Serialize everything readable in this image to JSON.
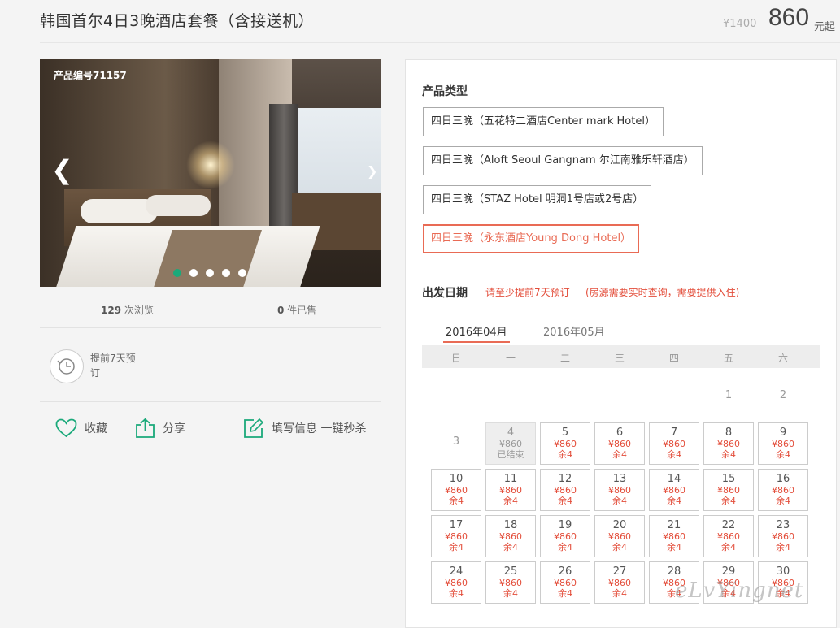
{
  "header": {
    "title": "韩国首尔4日3晚酒店套餐（含接送机）",
    "old_price": "¥1400",
    "price": "860",
    "price_unit": "元起"
  },
  "gallery": {
    "product_id": "产品编号71157",
    "slide_count": 5,
    "active_slide": 1
  },
  "stats": {
    "views_num": "129",
    "views_label": " 次浏览",
    "sold_num": "0",
    "sold_label": " 件已售"
  },
  "booking_note": "提前7天预订",
  "actions": {
    "favorite": "收藏",
    "share": "分享",
    "fill_info": "填写信息 一键秒杀"
  },
  "product_type": {
    "title": "产品类型",
    "options": [
      "四日三晚（五花特二酒店Center mark Hotel）",
      "四日三晚（Aloft Seoul Gangnam 尔江南雅乐轩酒店）",
      "四日三晚（STAZ Hotel 明洞1号店或2号店）",
      "四日三晚（永东酒店Young Dong Hotel）"
    ],
    "selected": 3
  },
  "departure": {
    "title": "出发日期",
    "note1": "请至少提前7天预订",
    "note2": "(房源需要实时查询，需要提供入住)"
  },
  "calendar": {
    "months": [
      "2016年04月",
      "2016年05月"
    ],
    "active_month": 0,
    "weekdays": [
      "日",
      "一",
      "二",
      "三",
      "四",
      "五",
      "六"
    ],
    "ended_label": "已结束",
    "days": [
      {
        "d": "1",
        "p": "",
        "s": ""
      },
      {
        "d": "2",
        "p": "",
        "s": ""
      },
      {
        "d": "3",
        "p": "",
        "s": ""
      },
      {
        "d": "4",
        "p": "¥860",
        "s": "已结束"
      },
      {
        "d": "5",
        "p": "¥860",
        "s": "余4"
      },
      {
        "d": "6",
        "p": "¥860",
        "s": "余4"
      },
      {
        "d": "7",
        "p": "¥860",
        "s": "余4"
      },
      {
        "d": "8",
        "p": "¥860",
        "s": "余4"
      },
      {
        "d": "9",
        "p": "¥860",
        "s": "余4"
      },
      {
        "d": "10",
        "p": "¥860",
        "s": "余4"
      },
      {
        "d": "11",
        "p": "¥860",
        "s": "余4"
      },
      {
        "d": "12",
        "p": "¥860",
        "s": "余4"
      },
      {
        "d": "13",
        "p": "¥860",
        "s": "余4"
      },
      {
        "d": "14",
        "p": "¥860",
        "s": "余4"
      },
      {
        "d": "15",
        "p": "¥860",
        "s": "余4"
      },
      {
        "d": "16",
        "p": "¥860",
        "s": "余4"
      },
      {
        "d": "17",
        "p": "¥860",
        "s": "余4"
      },
      {
        "d": "18",
        "p": "¥860",
        "s": "余4"
      },
      {
        "d": "19",
        "p": "¥860",
        "s": "余4"
      },
      {
        "d": "20",
        "p": "¥860",
        "s": "余4"
      },
      {
        "d": "21",
        "p": "¥860",
        "s": "余4"
      },
      {
        "d": "22",
        "p": "¥860",
        "s": "余4"
      },
      {
        "d": "23",
        "p": "¥860",
        "s": "余4"
      },
      {
        "d": "24",
        "p": "¥860",
        "s": "余4"
      },
      {
        "d": "25",
        "p": "¥860",
        "s": "余4"
      },
      {
        "d": "26",
        "p": "¥860",
        "s": "余4"
      },
      {
        "d": "27",
        "p": "¥860",
        "s": "余4"
      },
      {
        "d": "28",
        "p": "¥860",
        "s": "余4"
      },
      {
        "d": "29",
        "p": "¥860",
        "s": "余4"
      },
      {
        "d": "30",
        "p": "¥860",
        "s": "余4"
      }
    ]
  },
  "watermark": "eLvYingnet",
  "colors": {
    "accent": "#e96b55",
    "price_red": "#e34e3b",
    "green": "#1aa97a"
  }
}
